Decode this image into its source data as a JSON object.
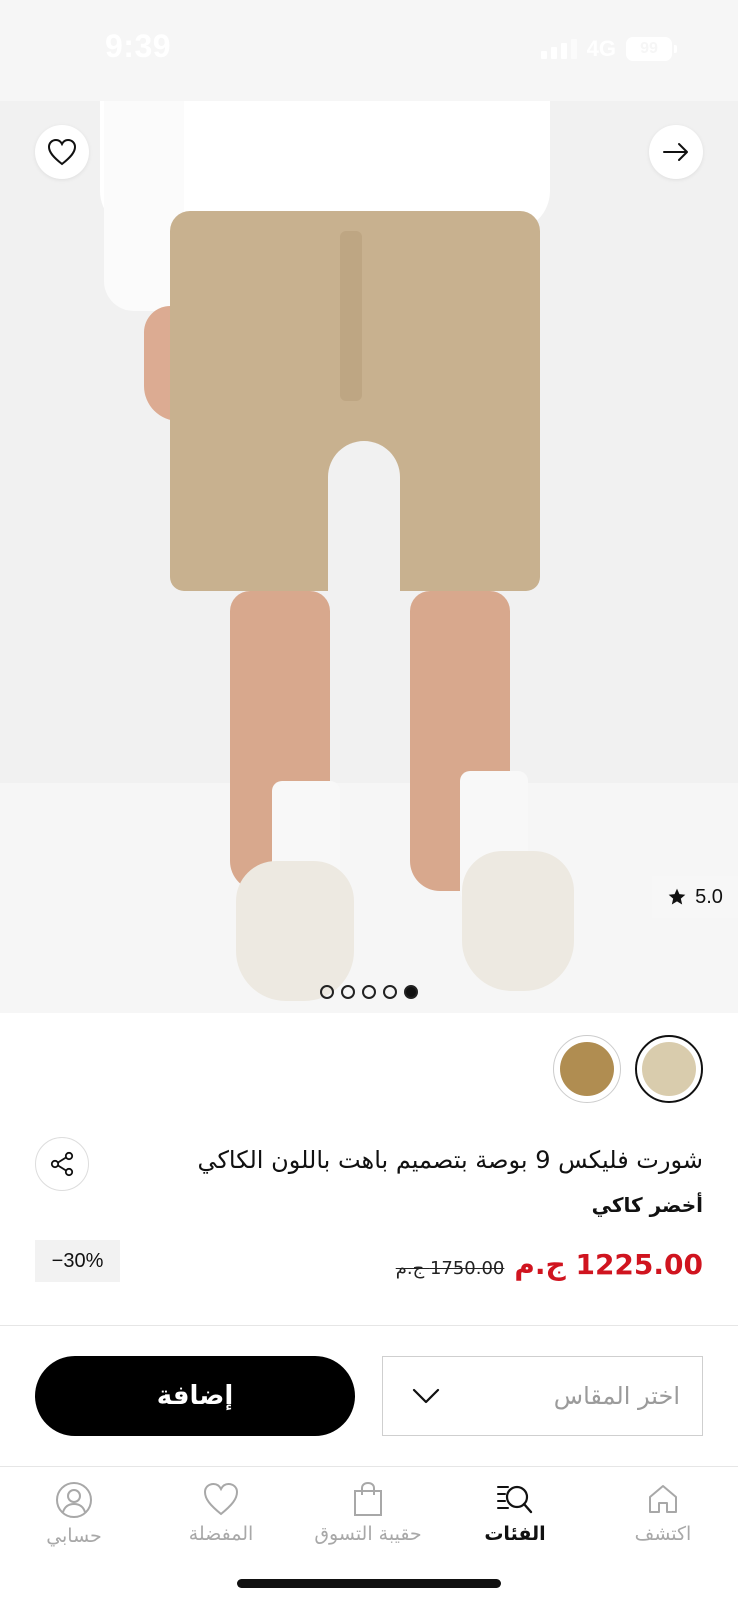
{
  "status_bar": {
    "time": "9:39",
    "network": "4G",
    "battery": "99"
  },
  "product": {
    "rating": "5.0",
    "image_count": 5,
    "active_image_index": 4,
    "colors": [
      {
        "name": "beige",
        "hex": "#d9ccad",
        "selected": true
      },
      {
        "name": "khaki",
        "hex": "#b08d51",
        "selected": false
      }
    ],
    "title": "شورت فليكس 9 بوصة بتصميم باهت باللون الكاكي",
    "color_name": "أخضر كاكي",
    "price": "1225.00 ج.م",
    "old_price": "1750.00 ج.م",
    "discount": "−30%"
  },
  "actions": {
    "size_placeholder": "اختر المقاس",
    "add_label": "إضافة"
  },
  "bottom_nav": {
    "items": [
      {
        "label": "اكتشف",
        "icon": "home-icon",
        "active": false
      },
      {
        "label": "الفئات",
        "icon": "categories-search-icon",
        "active": true
      },
      {
        "label": "حقيبة التسوق",
        "icon": "shopping-bag-icon",
        "active": false
      },
      {
        "label": "المفضلة",
        "icon": "heart-icon",
        "active": false
      },
      {
        "label": "حسابي",
        "icon": "user-icon",
        "active": false
      }
    ]
  },
  "colors": {
    "price_red": "#d0141f",
    "primary_black": "#000000",
    "muted_gray": "#a8a8a8"
  }
}
